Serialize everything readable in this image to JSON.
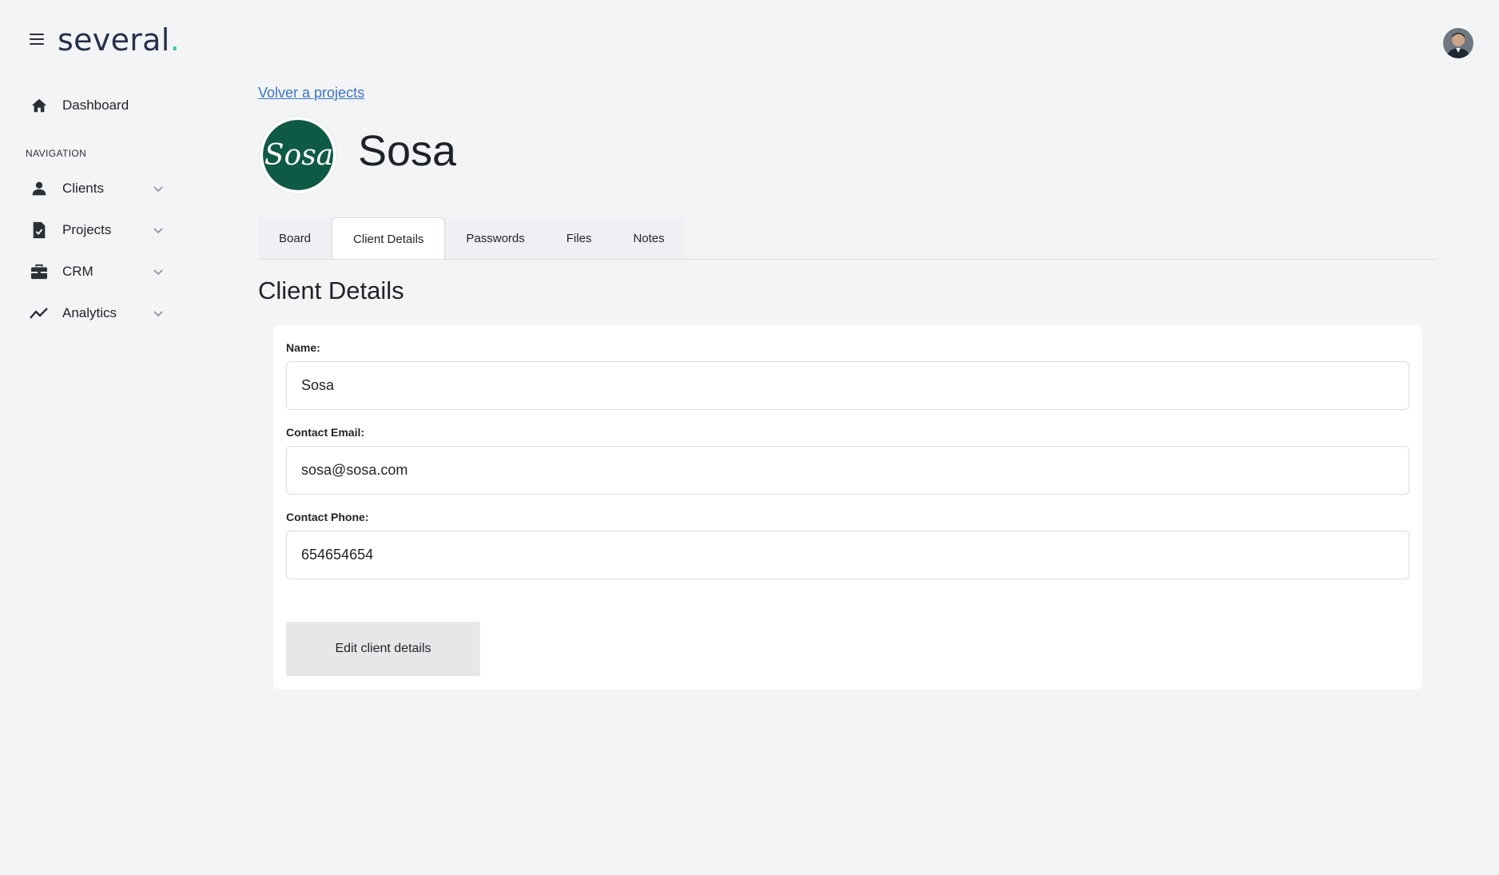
{
  "app": {
    "logo_text": "several",
    "logo_dot": ".",
    "accent_color": "#3ac7a0",
    "brand_color": "#27304a"
  },
  "sidebar": {
    "dashboard_label": "Dashboard",
    "section_label": "NAVIGATION",
    "items": [
      {
        "label": "Clients",
        "icon": "person-icon"
      },
      {
        "label": "Projects",
        "icon": "document-check-icon"
      },
      {
        "label": "CRM",
        "icon": "briefcase-icon"
      },
      {
        "label": "Analytics",
        "icon": "trending-line-icon"
      }
    ]
  },
  "main": {
    "back_link": "Volver a projects",
    "client_name": "Sosa",
    "client_logo_text": "Sosa",
    "client_logo_color": "#0f5a45",
    "tabs": [
      {
        "label": "Board",
        "active": false
      },
      {
        "label": "Client Details",
        "active": true
      },
      {
        "label": "Passwords",
        "active": false
      },
      {
        "label": "Files",
        "active": false
      },
      {
        "label": "Notes",
        "active": false
      }
    ],
    "section_title": "Client Details"
  },
  "form": {
    "name_label": "Name:",
    "name_value": "Sosa",
    "email_label": "Contact Email:",
    "email_value": "sosa@sosa.com",
    "phone_label": "Contact Phone:",
    "phone_value": "654654654",
    "edit_button": "Edit client details"
  }
}
